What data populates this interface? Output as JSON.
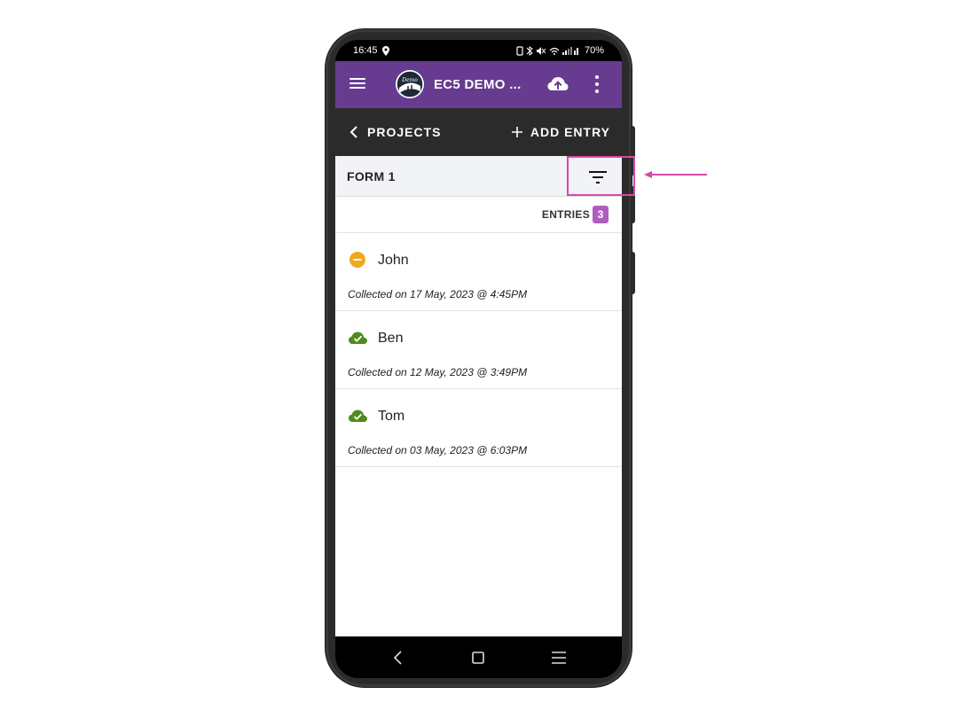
{
  "status_bar": {
    "time": "16:45",
    "battery": "70%"
  },
  "app_bar": {
    "title": "EC5 DEMO ...",
    "logo_text": "Demo"
  },
  "nav": {
    "back_label": "PROJECTS",
    "add_label": "ADD ENTRY"
  },
  "form": {
    "title": "FORM 1"
  },
  "entries": {
    "label": "ENTRIES",
    "count": "3",
    "items": [
      {
        "name": "John",
        "collected": "Collected on 17 May, 2023 @ 4:45PM",
        "status": "pending-icon"
      },
      {
        "name": "Ben",
        "collected": "Collected on 12 May, 2023 @ 3:49PM",
        "status": "synced-cloud-icon"
      },
      {
        "name": "Tom",
        "collected": "Collected on 03 May, 2023 @ 6:03PM",
        "status": "synced-cloud-icon"
      }
    ]
  },
  "colors": {
    "app_bar": "#673c90",
    "nav_bar": "#2b2b2b",
    "badge": "#b05cc0",
    "pending": "#f2a81d",
    "synced": "#4f8c1e",
    "annotation": "#d64aa6"
  }
}
